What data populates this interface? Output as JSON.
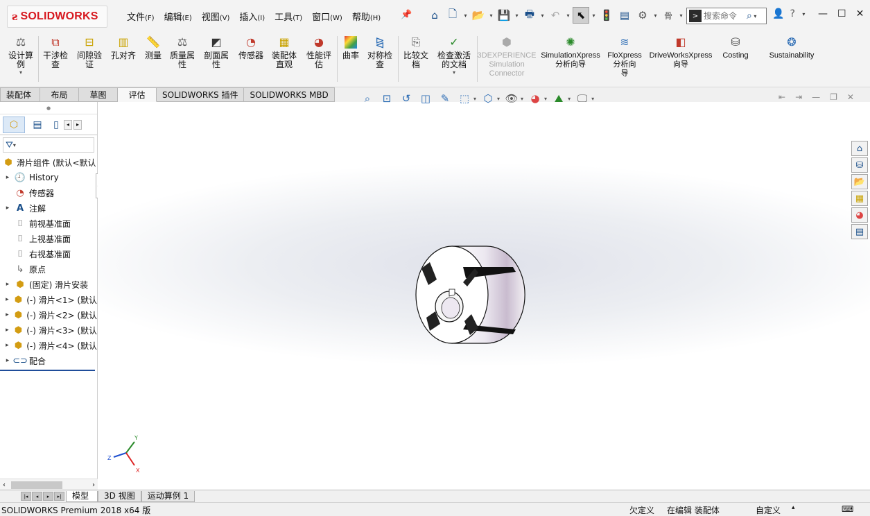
{
  "app": {
    "logo_text": "SOLIDWORKS"
  },
  "menu": [
    {
      "label": "文件",
      "accel": "(F)"
    },
    {
      "label": "编辑",
      "accel": "(E)"
    },
    {
      "label": "视图",
      "accel": "(V)"
    },
    {
      "label": "插入",
      "accel": "(I)"
    },
    {
      "label": "工具",
      "accel": "(T)"
    },
    {
      "label": "窗口",
      "accel": "(W)"
    },
    {
      "label": "帮助",
      "accel": "(H)"
    }
  ],
  "quick_access": [
    "home-icon",
    "new-icon",
    "open-icon",
    "save-icon",
    "print-icon",
    "undo-icon",
    "select-icon",
    "rebuild-icon",
    "file-properties-icon",
    "options-icon"
  ],
  "search": {
    "placeholder": "搜索命令"
  },
  "ribbon": [
    {
      "label": "设计算\n例",
      "icon": "design-study-icon"
    },
    {
      "label": "干涉检\n查",
      "icon": "interference-check-icon"
    },
    {
      "label": "间隙验\n证",
      "icon": "clearance-verification-icon"
    },
    {
      "label": "孔对齐",
      "icon": "hole-alignment-icon"
    },
    {
      "label": "测量",
      "icon": "measure-icon"
    },
    {
      "label": "质量属\n性",
      "icon": "mass-properties-icon"
    },
    {
      "label": "剖面属\n性",
      "icon": "section-properties-icon"
    },
    {
      "label": "传感器",
      "icon": "sensor-icon"
    },
    {
      "label": "装配体\n直观",
      "icon": "assembly-visualization-icon"
    },
    {
      "label": "性能评\n估",
      "icon": "performance-evaluation-icon"
    },
    {
      "label": "曲率",
      "icon": "curvature-icon"
    },
    {
      "label": "对称检\n查",
      "icon": "symmetry-check-icon"
    },
    {
      "label": "比较文\n档",
      "icon": "compare-documents-icon"
    },
    {
      "label": "检查激活\n的文档",
      "icon": "check-active-document-icon"
    },
    {
      "label": "3DEXPERIENCE\nSimulation\nConnector",
      "icon": "3dexperience-icon"
    },
    {
      "label": "SimulationXpress\n分析向导",
      "icon": "simulationxpress-icon"
    },
    {
      "label": "FloXpress\n分析向\n导",
      "icon": "floxpress-icon"
    },
    {
      "label": "DriveWorksXpress\n向导",
      "icon": "driveworksxpress-icon"
    },
    {
      "label": "Costing",
      "icon": "costing-icon"
    },
    {
      "label": "Sustainability",
      "icon": "sustainability-icon"
    }
  ],
  "tabs": [
    {
      "label": "装配体"
    },
    {
      "label": "布局"
    },
    {
      "label": "草图"
    },
    {
      "label": "评估",
      "active": true
    },
    {
      "label": "SOLIDWORKS 插件"
    },
    {
      "label": "SOLIDWORKS MBD"
    }
  ],
  "tree": {
    "root": "滑片组件 (默认<默认",
    "items": [
      {
        "label": "History",
        "icon": "history-icon",
        "expandable": true
      },
      {
        "label": "传感器",
        "icon": "sensor-icon",
        "expandable": false
      },
      {
        "label": "注解",
        "icon": "annotations-icon",
        "expandable": true
      },
      {
        "label": "前视基准面",
        "icon": "plane-icon",
        "expandable": false
      },
      {
        "label": "上视基准面",
        "icon": "plane-icon",
        "expandable": false
      },
      {
        "label": "右视基准面",
        "icon": "plane-icon",
        "expandable": false
      },
      {
        "label": "原点",
        "icon": "origin-icon",
        "expandable": false
      },
      {
        "label": "(固定) 滑片安装",
        "icon": "part-icon",
        "expandable": true
      },
      {
        "label": "(-) 滑片<1> (默认",
        "icon": "part-icon",
        "expandable": true
      },
      {
        "label": "(-) 滑片<2> (默认",
        "icon": "part-icon",
        "expandable": true
      },
      {
        "label": "(-) 滑片<3> (默认",
        "icon": "part-icon",
        "expandable": true
      },
      {
        "label": "(-) 滑片<4> (默认",
        "icon": "part-icon",
        "expandable": true
      },
      {
        "label": "配合",
        "icon": "mates-icon",
        "expandable": true
      }
    ]
  },
  "triad": {
    "y": "Y",
    "z": "Z",
    "x": "X"
  },
  "bottom_tabs": [
    {
      "label": "模型",
      "active": true
    },
    {
      "label": "3D 视图"
    },
    {
      "label": "运动算例 1"
    }
  ],
  "status": {
    "product": "SOLIDWORKS Premium 2018 x64 版",
    "definition": "欠定义",
    "editing": "在编辑 装配体",
    "units": "自定义"
  }
}
